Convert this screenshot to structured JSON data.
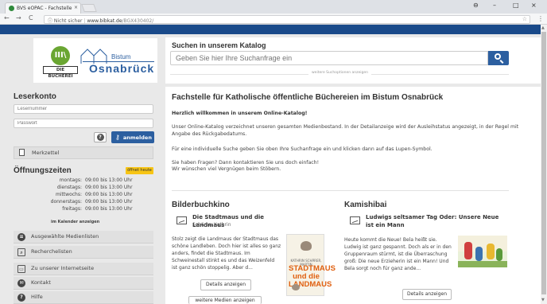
{
  "browser": {
    "tab_title": "BVS eOPAC - Fachstelle",
    "tab_close": "×",
    "back": "←",
    "forward": "→",
    "reload": "C",
    "security": "ⓘ Nicht sicher",
    "url_host": "www.bibkat.de",
    "url_path": "/BGX430402/",
    "star": "☆",
    "menu": "⋮",
    "account_icon": "⊖",
    "minimize": "–",
    "maximize": "□",
    "close": "×"
  },
  "logo": {
    "circle_text": "III\\",
    "bar_text": "DIE BÜCHEREI",
    "bistum": "Bistum",
    "city": "Osnabrück"
  },
  "sidebar": {
    "account_heading": "Leserkonto",
    "reader_number_placeholder": "Lesernummer",
    "password_placeholder": "Passwort",
    "help_label": "?",
    "login_label": "anmelden",
    "merkzettel_label": "Merkzettel",
    "hours_heading": "Öffnungszeiten",
    "open_badge": "öffnet heute",
    "hours": [
      {
        "day": "montags:",
        "time": "09:00 bis 13:00 Uhr"
      },
      {
        "day": "dienstags:",
        "time": "09:00 bis 13:00 Uhr"
      },
      {
        "day": "mittwochs:",
        "time": "09:00 bis 13:00 Uhr"
      },
      {
        "day": "donnerstags:",
        "time": "09:00 bis 13:00 Uhr"
      },
      {
        "day": "freitags:",
        "time": "09:00 bis 13:00 Uhr"
      }
    ],
    "calendar_note": "im Kalender anzeigen",
    "links": [
      {
        "label": "Ausgewählte Medienlisten",
        "icon": "≡"
      },
      {
        "label": "Recherchelisten",
        "icon": "⌕"
      },
      {
        "label": "Zu unserer Internetseite",
        "icon": "▭"
      },
      {
        "label": "Kontakt",
        "icon": "✉"
      },
      {
        "label": "Hilfe",
        "icon": "?"
      }
    ]
  },
  "search": {
    "title": "Suchen in unserem Katalog",
    "placeholder": "Geben Sie hier Ihre Suchanfrage ein",
    "suggestions_link": "weitere Suchoptionen anzeigen"
  },
  "intro": {
    "title": "Fachstelle für Katholische öffentliche Büchereien im Bistum Osnabrück",
    "welcome": "Herzlich willkommen in unserem Online-Katalog!",
    "p1": "Unser Online-Katalog verzeichnet unseren gesamten Medienbestand. In der Detailanzeige wird der Ausleihstatus angezeigt, in der Regel mit Angabe des Rückgabedatums.",
    "p2": "Für eine individuelle Suche geben Sie oben Ihre Suchanfrage ein und klicken dann auf das Lupen-Symbol.",
    "p3a": "Sie haben Fragen? Dann kontaktieren Sie uns doch einfach!",
    "p3b": "Wir wünschen viel Vergnügen beim Stöbern."
  },
  "bilderbuchkino": {
    "heading": "Bilderbuchkino",
    "title": "Die Stadtmaus und die Landmaus",
    "author": "Schärer, Kathrin",
    "text": "Stolz zeigt die Landmaus der Stadtmaus das schöne Landleben. Doch hier ist alles so ganz anders, findet die Stadtmaus. Im Schweinestall stinkt es und das Weizenfeld ist ganz schön stoppelig. Aber d...",
    "details_button": "Details anzeigen",
    "more_button": "weitere Medien anzeigen",
    "cover_label": "KATHRIN SCHÄRER, MARTIN",
    "cover_title": "STADTMAUS und die LANDMAUS"
  },
  "kamishibai": {
    "heading": "Kamishibai",
    "title": "Ludwigs seltsamer Tag Oder: Unsere Neue ist ein Mann",
    "text": "Heute kommt die Neue! Bela heißt sie. Ludwig ist ganz gespannt. Doch als er in den Gruppenraum stürmt, ist die Überraschung groß: Die neue Erzieherin ist ein Mann! Und Bela sorgt noch für ganz ande...",
    "details_button": "Details anzeigen"
  },
  "colors": {
    "brand_blue": "#2c5fa0",
    "top_band": "#1a4a8a",
    "badge_yellow": "#f7c515",
    "logo_green": "#6aa632"
  }
}
